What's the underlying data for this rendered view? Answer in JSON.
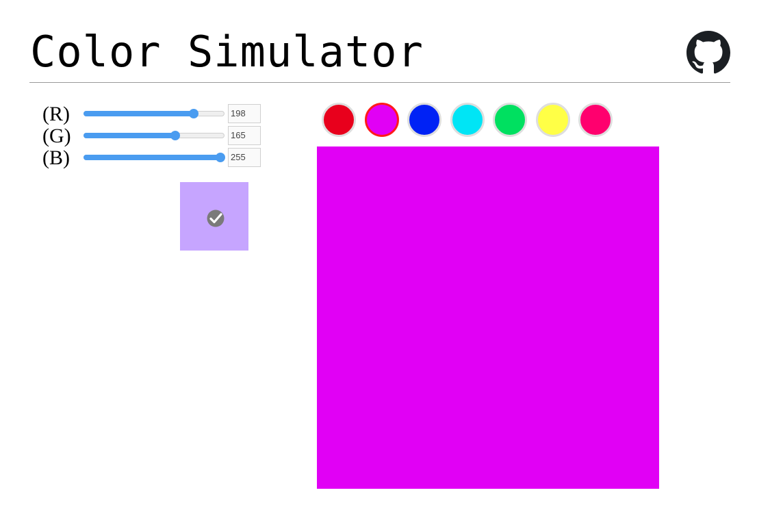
{
  "header": {
    "title": "Color Simulator",
    "github_icon": "github-icon"
  },
  "sliders": [
    {
      "label": "(R)",
      "value": 198,
      "max": 255,
      "name": "red"
    },
    {
      "label": "(G)",
      "value": 165,
      "max": 255,
      "name": "green"
    },
    {
      "label": "(B)",
      "value": 255,
      "max": 255,
      "name": "blue"
    }
  ],
  "preview": {
    "color": "#c6a5ff",
    "icon": "check-circle-icon"
  },
  "swatches": [
    {
      "color": "#e8001c",
      "selected": false
    },
    {
      "color": "#e100f5",
      "selected": true
    },
    {
      "color": "#0022f5",
      "selected": false
    },
    {
      "color": "#00e5f5",
      "selected": false
    },
    {
      "color": "#00e060",
      "selected": false
    },
    {
      "color": "#ffff46",
      "selected": false
    },
    {
      "color": "#ff006e",
      "selected": false
    }
  ],
  "canvas": {
    "color": "#e100f5"
  },
  "colors": {
    "slider_accent": "#4a9cf0",
    "divider": "#9a9a9a",
    "selected_ring": "#ff1a1a"
  }
}
